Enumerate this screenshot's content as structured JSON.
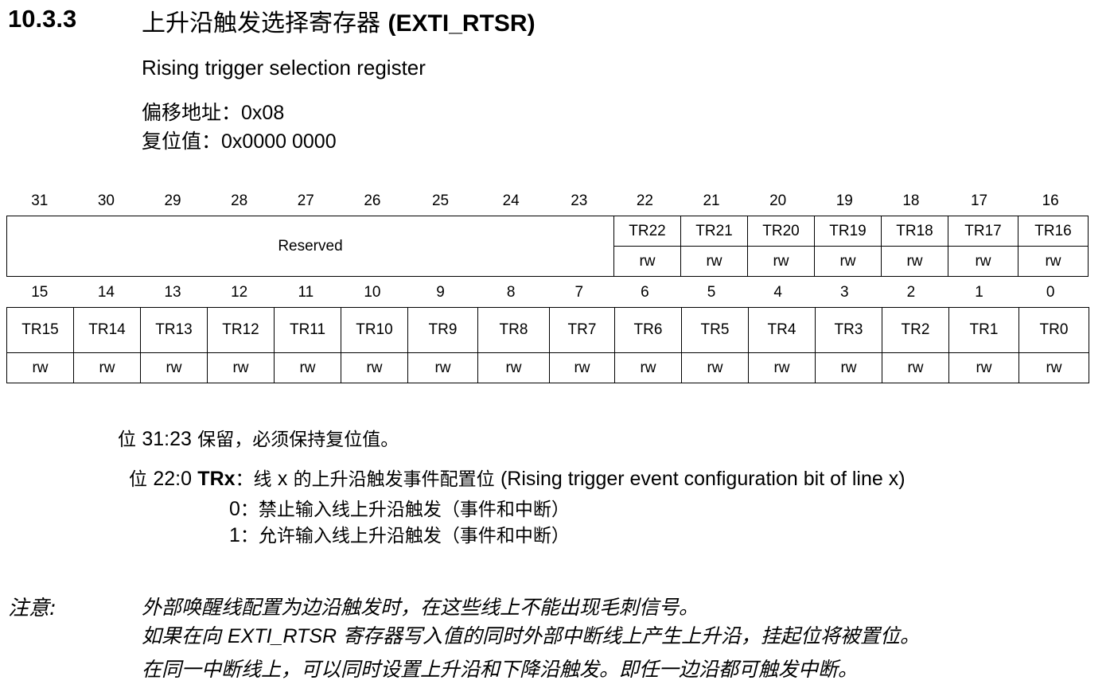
{
  "section": {
    "number": "10.3.3",
    "title_cn": "上升沿触发选择寄存器",
    "title_reg": "(EXTI_RTSR)",
    "subtitle": "Rising trigger selection register",
    "offset_label": "偏移地址：",
    "offset_value": "0x08",
    "reset_label": "复位值：",
    "reset_value": "0x0000 0000"
  },
  "upper": {
    "bits": [
      "31",
      "30",
      "29",
      "28",
      "27",
      "26",
      "25",
      "24",
      "23",
      "22",
      "21",
      "20",
      "19",
      "18",
      "17",
      "16"
    ],
    "reserved": "Reserved",
    "fields": [
      "TR22",
      "TR21",
      "TR20",
      "TR19",
      "TR18",
      "TR17",
      "TR16"
    ],
    "access": [
      "rw",
      "rw",
      "rw",
      "rw",
      "rw",
      "rw",
      "rw"
    ]
  },
  "lower": {
    "bits": [
      "15",
      "14",
      "13",
      "12",
      "11",
      "10",
      "9",
      "8",
      "7",
      "6",
      "5",
      "4",
      "3",
      "2",
      "1",
      "0"
    ],
    "fields": [
      "TR15",
      "TR14",
      "TR13",
      "TR12",
      "TR11",
      "TR10",
      "TR9",
      "TR8",
      "TR7",
      "TR6",
      "TR5",
      "TR4",
      "TR3",
      "TR2",
      "TR1",
      "TR0"
    ],
    "access": [
      "rw",
      "rw",
      "rw",
      "rw",
      "rw",
      "rw",
      "rw",
      "rw",
      "rw",
      "rw",
      "rw",
      "rw",
      "rw",
      "rw",
      "rw",
      "rw"
    ]
  },
  "desc": {
    "bit31_label_cn": "位",
    "bit31_range": "31:23",
    "bit31_text": "保留，必须保持复位值。",
    "bit22_label_cn": "位",
    "bit22_range": "22:0",
    "bit22_field": "TRx",
    "bit22_colon": "：线",
    "bit22_x": "x",
    "bit22_text_cn": "的上升沿触发事件配置位",
    "bit22_text_en": "(Rising trigger event configuration bit of line x)",
    "opt0_num": "0",
    "opt0_text": "：禁止输入线上升沿触发（事件和中断）",
    "opt1_num": "1",
    "opt1_text": "：允许输入线上升沿触发（事件和中断）"
  },
  "note": {
    "label": "注意:",
    "line1": "外部唤醒线配置为边沿触发时，在这些线上不能出现毛刺信号。",
    "line2_pre": "如果在向",
    "line2_reg": "EXTI_RTSR",
    "line2_post": "寄存器写入值的同时外部中断线上产生上升沿，挂起位将被置位。",
    "line3": "在同一中断线上，可以同时设置上升沿和下降沿触发。即任一边沿都可触发中断。"
  }
}
